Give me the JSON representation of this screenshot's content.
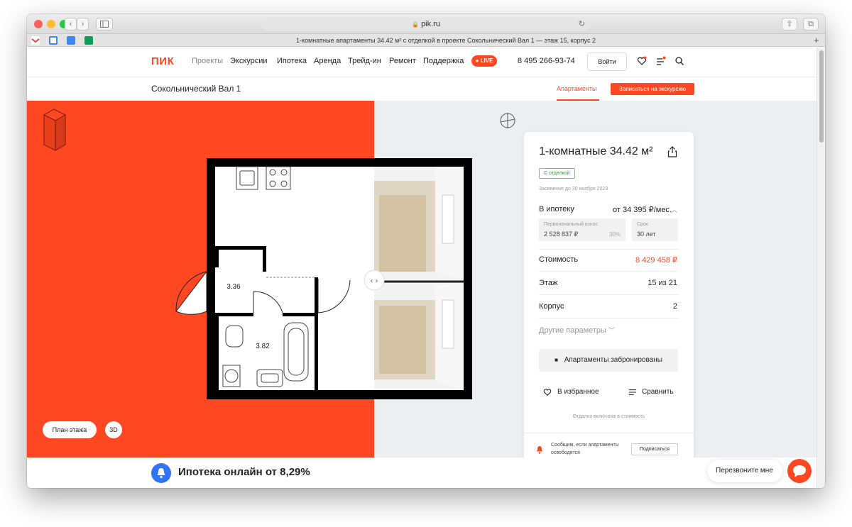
{
  "browser": {
    "url": "pik.ru",
    "tab_title": "1-комнатные апартаменты 34.42 м² с отделкой в проекте Сокольнический Вал 1 — этаж 15, корпус 2"
  },
  "nav": {
    "logo": "ПИК",
    "links": [
      "Проекты",
      "Экскурсии",
      "Ипотека",
      "Аренда",
      "Трейд-ин",
      "Ремонт",
      "Поддержка"
    ],
    "live": "LIVE",
    "phone": "8 495 266-93-74",
    "login": "Войти"
  },
  "subnav": {
    "project": "Сокольнический Вал 1",
    "tab": "Апартаменты",
    "excursion_button": "Записаться на экскурсию"
  },
  "plan": {
    "room1_area": "3.36",
    "room2_area": "3.82",
    "floor_plan_button": "План этажа",
    "view_3d_button": "3D"
  },
  "card": {
    "title": "1-комнатные 34.42 м²",
    "badge": "С отделкой",
    "settlement": "Заселение до 30 ноября 2023",
    "mortgage_label": "В ипотеку",
    "mortgage_value": "от 34 395 ₽/мес.",
    "down_payment_label": "Первоначальный взнос",
    "down_payment_value": "2 528 837 ₽",
    "down_payment_percent": "30%",
    "term_label": "Срок",
    "term_value": "30 лет",
    "price_label": "Стоимость",
    "price_value": "8 429 458 ₽",
    "floor_label": "Этаж",
    "floor_value": "15 из 21",
    "building_label": "Корпус",
    "building_value": "2",
    "other_params": "Другие параметры",
    "reserved": "Апартаменты забронированы",
    "favorite": "В избранное",
    "compare": "Сравнить",
    "finishing_note": "Отделка включена в стоимость",
    "notify_text_1": "Сообщим, если апартаменты",
    "notify_text_2": "освободятся",
    "subscribe": "Подписаться"
  },
  "bottom": {
    "mortgage_banner": "Ипотека онлайн от 8,29%",
    "callback": "Перезвоните мне"
  },
  "colors": {
    "accent": "#ff4721",
    "plan_background": "#eceef2",
    "banner_blue": "#2f74f6",
    "badge_green": "#3c9c3c"
  }
}
